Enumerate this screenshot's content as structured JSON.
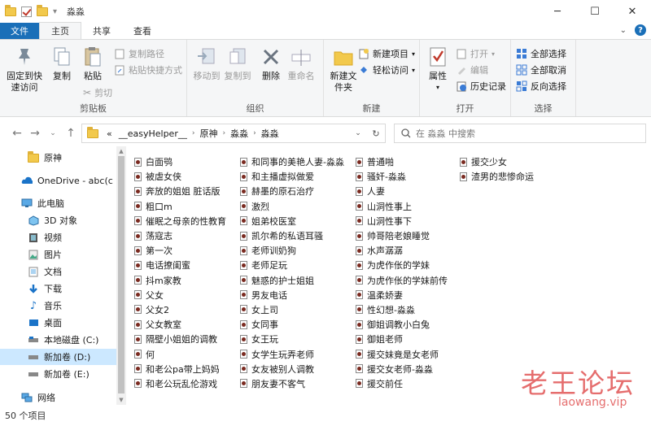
{
  "window": {
    "title": "淼淼"
  },
  "tabs": {
    "file": "文件",
    "home": "主页",
    "share": "共享",
    "view": "查看"
  },
  "ribbon": {
    "clipboard": {
      "label": "剪贴板",
      "pin": "固定到快速访问",
      "copy": "复制",
      "paste": "粘贴",
      "copy_path": "复制路径",
      "paste_shortcut": "粘贴快捷方式",
      "cut": "剪切"
    },
    "organize": {
      "label": "组织",
      "move_to": "移动到",
      "copy_to": "复制到",
      "delete": "删除",
      "rename": "重命名"
    },
    "new": {
      "label": "新建",
      "new_folder": "新建文件夹",
      "new_item": "新建项目",
      "easy_access": "轻松访问"
    },
    "open": {
      "label": "打开",
      "properties": "属性",
      "open": "打开",
      "edit": "编辑",
      "history": "历史记录"
    },
    "select": {
      "label": "选择",
      "select_all": "全部选择",
      "select_none": "全部取消",
      "invert": "反向选择"
    }
  },
  "address": {
    "overflow": "«",
    "crumbs": [
      "__easyHelper__",
      "原神",
      "淼淼",
      "淼淼"
    ]
  },
  "search": {
    "placeholder": "在 淼淼 中搜索"
  },
  "nav": [
    {
      "label": "原神",
      "icon": "folder-icon"
    },
    {
      "label": "OneDrive - abc(c",
      "icon": "cloud-icon"
    },
    {
      "label": "此电脑",
      "icon": "pc-icon"
    },
    {
      "label": "3D 对象",
      "icon": "cube-icon"
    },
    {
      "label": "视频",
      "icon": "video-icon"
    },
    {
      "label": "图片",
      "icon": "picture-icon"
    },
    {
      "label": "文档",
      "icon": "document-icon"
    },
    {
      "label": "下载",
      "icon": "download-icon"
    },
    {
      "label": "音乐",
      "icon": "music-icon"
    },
    {
      "label": "桌面",
      "icon": "desktop-icon"
    },
    {
      "label": "本地磁盘 (C:)",
      "icon": "drive-icon"
    },
    {
      "label": "新加卷 (D:)",
      "icon": "drive-icon"
    },
    {
      "label": "新加卷 (E:)",
      "icon": "drive-icon"
    },
    {
      "label": "网络",
      "icon": "network-icon"
    }
  ],
  "files": {
    "col1": [
      "白面鸮",
      "被虐女侠",
      "奔放的姐姐 脏话版",
      "粗口m",
      "催眠之母亲的性教育",
      "荡寇志",
      "第一次",
      "电话撩闺蜜",
      "抖m家教",
      "父女",
      "父女2",
      "父女教室",
      "隔壁小姐姐的调教",
      "何",
      "和老公pa带上妈妈",
      "和老公玩乱伦游戏"
    ],
    "col2": [
      "和同事的美艳人妻-淼淼",
      "和主播虚拟做爱",
      "赫墨的原石治疗",
      "激烈",
      "姐弟校医室",
      "凯尔希的私语耳骚",
      "老师训奶狗",
      "老师足玩",
      "魅惑的护士姐姐",
      "男友电话",
      "女上司",
      "女同事",
      "女王玩",
      "女学生玩弄老师",
      "女友被别人调教",
      "朋友妻不客气"
    ],
    "col3": [
      "普通啪",
      "骚奸-淼淼",
      "人妻",
      "山洞性事上",
      "山洞性事下",
      "帅哥陪老娘睡觉",
      "水声潺潺",
      "为虎作伥的学妹",
      "为虎作伥的学妹前传",
      "温柔娇妻",
      "性幻想-淼淼",
      "御姐调教小白兔",
      "御姐老师",
      "援交妹竟是女老师",
      "援交女老师-淼淼",
      "援交前任"
    ],
    "col4": [
      "援交少女",
      "渣男的悲惨命运"
    ]
  },
  "status": {
    "count": "50 个项目"
  },
  "watermark": {
    "cn": "老王论坛",
    "en": "laowang.vip"
  }
}
